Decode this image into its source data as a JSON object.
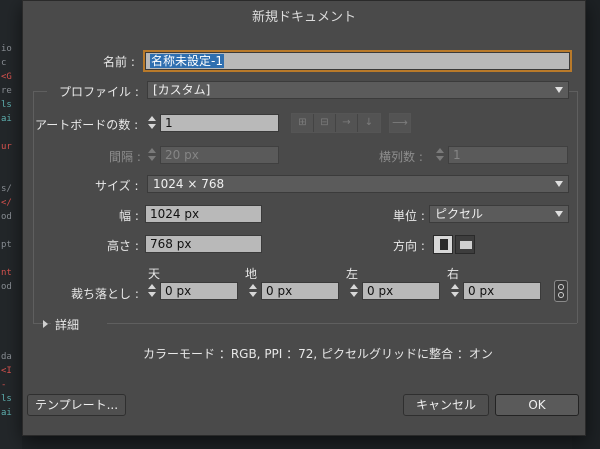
{
  "window": {
    "title": "新規ドキュメント"
  },
  "background": {
    "lines": [
      "io",
      "c",
      "<G",
      "re",
      "ls",
      "ai",
      "",
      "ur",
      "",
      "",
      "s/",
      "</",
      "od",
      "",
      "pt",
      "",
      "nt",
      "od",
      "",
      "",
      "",
      "",
      "da",
      "<I",
      "-",
      "ls",
      "ai"
    ]
  },
  "name": {
    "label": "名前 :",
    "value": "名称未設定-1"
  },
  "profile": {
    "label": "プロファイル :",
    "value": "[カスタム]"
  },
  "artboards": {
    "label": "アートボードの数 :",
    "value": "1"
  },
  "spacing": {
    "label": "間隔 :",
    "value": "20 px"
  },
  "columns": {
    "label": "横列数 :",
    "value": "1"
  },
  "size": {
    "label": "サイズ :",
    "value": "1024 × 768"
  },
  "width": {
    "label": "幅 :",
    "value": "1024 px"
  },
  "units": {
    "label": "単位 :",
    "value": "ピクセル"
  },
  "height": {
    "label": "高さ :",
    "value": "768 px"
  },
  "orientation": {
    "label": "方向 :",
    "selected": "portrait"
  },
  "bleed": {
    "label": "裁ち落とし :",
    "top": {
      "label": "天",
      "value": "0 px"
    },
    "bottom": {
      "label": "地",
      "value": "0 px"
    },
    "left": {
      "label": "左",
      "value": "0 px"
    },
    "right": {
      "label": "右",
      "value": "0 px"
    }
  },
  "advanced": {
    "label": "詳細"
  },
  "summary": "カラーモード ：RGB, PPI ：72, ピクセルグリッドに整合 ：オン",
  "buttons": {
    "templates": "テンプレート...",
    "cancel": "キャンセル",
    "ok": "OK"
  },
  "colors": {
    "dialog_bg": "#4a4a4a",
    "field_bg": "#b9b9b9",
    "focus_ring": "#b97a2a",
    "selection": "#2f6fb0"
  }
}
